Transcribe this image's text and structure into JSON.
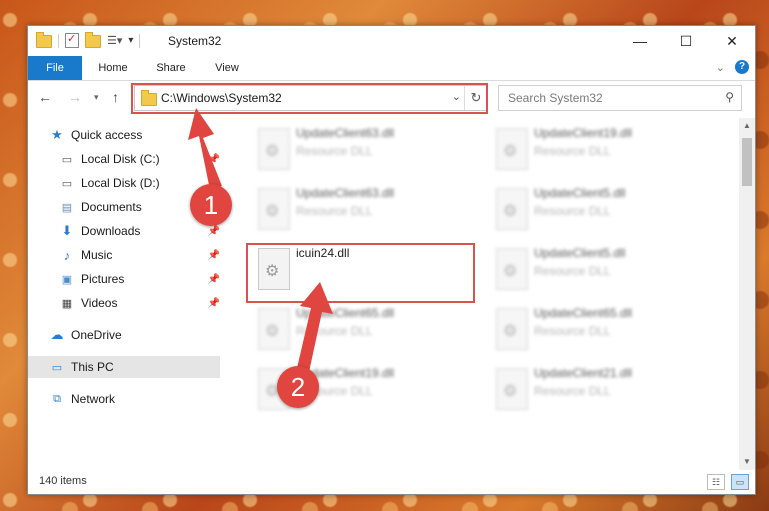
{
  "window": {
    "title": "System32"
  },
  "window_controls": {
    "minimize": "—",
    "maximize": "☐",
    "close": "✕"
  },
  "ribbon": {
    "tabs": [
      "File",
      "Home",
      "Share",
      "View"
    ],
    "help": "?"
  },
  "address_bar": {
    "path": "C:\\Windows\\System32"
  },
  "search": {
    "placeholder": "Search System32"
  },
  "nav_pane": {
    "items": [
      {
        "label": "Quick access",
        "icon": "star-icon"
      },
      {
        "label": "Local Disk (C:)",
        "icon": "drive-icon",
        "pinned": true
      },
      {
        "label": "Local Disk (D:)",
        "icon": "drive-icon",
        "pinned": true
      },
      {
        "label": "Documents",
        "icon": "documents-icon",
        "pinned": true
      },
      {
        "label": "Downloads",
        "icon": "downloads-icon",
        "pinned": true
      },
      {
        "label": "Music",
        "icon": "music-icon",
        "pinned": true
      },
      {
        "label": "Pictures",
        "icon": "pictures-icon",
        "pinned": true
      },
      {
        "label": "Videos",
        "icon": "videos-icon",
        "pinned": true
      },
      {
        "label": "OneDrive",
        "icon": "onedrive-icon"
      },
      {
        "label": "This PC",
        "icon": "this-pc-icon",
        "selected": true
      },
      {
        "label": "Network",
        "icon": "network-icon"
      }
    ]
  },
  "files": [
    {
      "name": "UpdateClient63.dll",
      "type": "Resource DLL",
      "blurred": true
    },
    {
      "name": "UpdateClient19.dll",
      "type": "Resource DLL",
      "blurred": true
    },
    {
      "name": "UpdateClient63.dll",
      "type": "Resource DLL",
      "blurred": true
    },
    {
      "name": "UpdateClient5.dll",
      "type": "Resource DLL",
      "blurred": true
    },
    {
      "name": "icuin24.dll",
      "type": "",
      "blurred": false,
      "highlighted": true
    },
    {
      "name": "UpdateClient5.dll",
      "type": "Resource DLL",
      "blurred": true
    },
    {
      "name": "UpdateClient65.dll",
      "type": "Resource DLL",
      "blurred": true
    },
    {
      "name": "UpdateClient65.dll",
      "type": "Resource DLL",
      "blurred": true
    },
    {
      "name": "UpdateClient19.dll",
      "type": "Resource DLL",
      "blurred": true
    },
    {
      "name": "UpdateClient21.dll",
      "type": "Resource DLL",
      "blurred": true
    }
  ],
  "status": {
    "item_count": "140 items"
  },
  "annotations": {
    "step1": "1",
    "step2": "2",
    "color": "#d8534f"
  }
}
